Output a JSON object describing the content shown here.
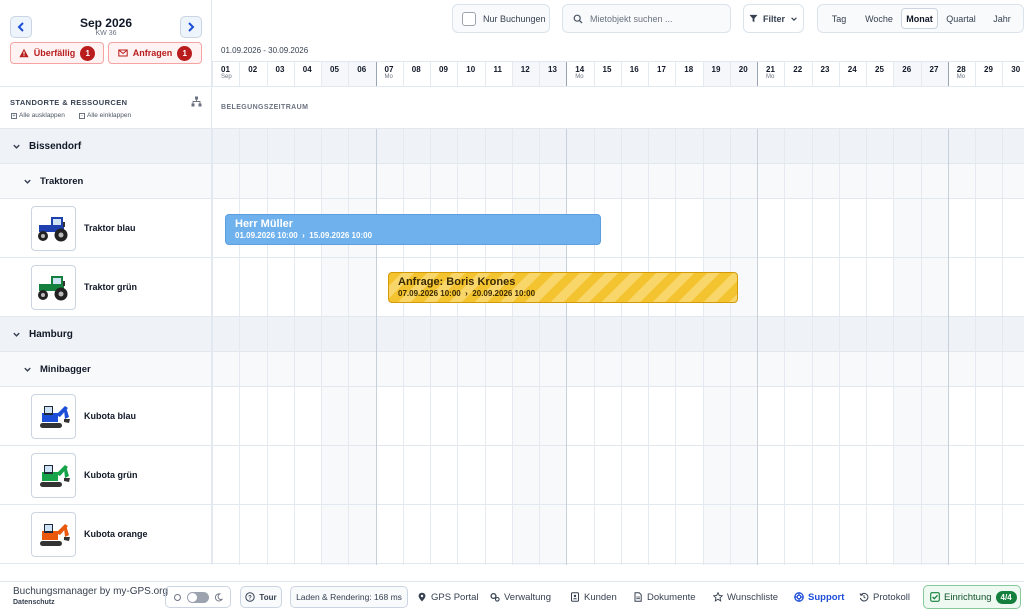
{
  "calendar": {
    "month_title": "Sep 2026",
    "week_label": "KW 36",
    "range_label": "01.09.2026 - 30.09.2026",
    "days": [
      {
        "num": "01",
        "sub": "Sep"
      },
      {
        "num": "02",
        "sub": ""
      },
      {
        "num": "03",
        "sub": ""
      },
      {
        "num": "04",
        "sub": ""
      },
      {
        "num": "05",
        "sub": ""
      },
      {
        "num": "06",
        "sub": ""
      },
      {
        "num": "07",
        "sub": "Mo"
      },
      {
        "num": "08",
        "sub": ""
      },
      {
        "num": "09",
        "sub": ""
      },
      {
        "num": "10",
        "sub": ""
      },
      {
        "num": "11",
        "sub": ""
      },
      {
        "num": "12",
        "sub": ""
      },
      {
        "num": "13",
        "sub": ""
      },
      {
        "num": "14",
        "sub": "Mo"
      },
      {
        "num": "15",
        "sub": ""
      },
      {
        "num": "16",
        "sub": ""
      },
      {
        "num": "17",
        "sub": ""
      },
      {
        "num": "18",
        "sub": ""
      },
      {
        "num": "19",
        "sub": ""
      },
      {
        "num": "20",
        "sub": ""
      },
      {
        "num": "21",
        "sub": "Mo"
      },
      {
        "num": "22",
        "sub": ""
      },
      {
        "num": "23",
        "sub": ""
      },
      {
        "num": "24",
        "sub": ""
      },
      {
        "num": "25",
        "sub": ""
      },
      {
        "num": "26",
        "sub": ""
      },
      {
        "num": "27",
        "sub": ""
      },
      {
        "num": "28",
        "sub": "Mo"
      },
      {
        "num": "29",
        "sub": ""
      },
      {
        "num": "30",
        "sub": ""
      }
    ],
    "weekend_day_indexes": [
      4,
      5,
      11,
      12,
      18,
      19,
      25,
      26
    ],
    "monday_day_indexes": [
      6,
      13,
      20,
      27
    ]
  },
  "alerts": {
    "overdue_label": "Überfällig",
    "overdue_count": "1",
    "requests_label": "Anfragen",
    "requests_count": "1"
  },
  "toolbar": {
    "only_bookings_label": "Nur Buchungen",
    "search_placeholder": "Mietobjekt suchen ...",
    "filter_label": "Filter",
    "views": [
      "Tag",
      "Woche",
      "Monat",
      "Quartal",
      "Jahr"
    ],
    "active_view": "Monat"
  },
  "resources": {
    "header_title": "STANDORTE & RESSOURCEN",
    "expand_all": "Alle ausklappen",
    "collapse_all": "Alle einklappen",
    "timeline_header": "BELEGUNGSZEITRAUM",
    "rows": [
      {
        "type": "group",
        "label": "Bissendorf"
      },
      {
        "type": "sub",
        "label": "Traktoren"
      },
      {
        "type": "res",
        "label": "Traktor blau",
        "icon": "tractor",
        "color": "#1e40af"
      },
      {
        "type": "res",
        "label": "Traktor grün",
        "icon": "tractor",
        "color": "#15803d"
      },
      {
        "type": "group",
        "label": "Hamburg"
      },
      {
        "type": "sub",
        "label": "Minibagger"
      },
      {
        "type": "res",
        "label": "Kubota blau",
        "icon": "excavator",
        "color": "#1d4ed8"
      },
      {
        "type": "res",
        "label": "Kubota grün",
        "icon": "excavator",
        "color": "#16a34a"
      },
      {
        "type": "res",
        "label": "Kubota orange",
        "icon": "excavator",
        "color": "#ea580c"
      }
    ]
  },
  "bookings": [
    {
      "title": "Herr Müller",
      "start": "01.09.2026 10:00",
      "end": "15.09.2026 10:00",
      "color": "#6fb1ec"
    },
    {
      "title": "Anfrage: Boris Krones",
      "start": "07.09.2026 10:00",
      "end": "20.09.2026 10:00",
      "color": "#f4c430"
    }
  ],
  "footer": {
    "app_title": "Buchungsmanager by my-GPS.org",
    "privacy": "Datenschutz",
    "tour": "Tour",
    "render_stats": "Laden & Rendering: 168 ms",
    "links": [
      {
        "label": "GPS Portal",
        "icon": "map-pin-icon"
      },
      {
        "label": "Verwaltung",
        "icon": "gears-icon"
      },
      {
        "label": "Kunden",
        "icon": "address-book-icon"
      },
      {
        "label": "Dokumente",
        "icon": "document-icon"
      },
      {
        "label": "Wunschliste",
        "icon": "star-icon"
      },
      {
        "label": "Support",
        "icon": "lifebuoy-icon"
      },
      {
        "label": "Protokoll",
        "icon": "history-icon"
      }
    ],
    "setup_label": "Einrichtung",
    "setup_progress": "4/4"
  }
}
